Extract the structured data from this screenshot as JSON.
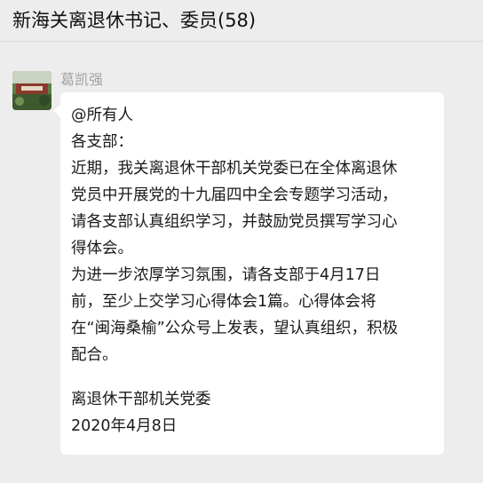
{
  "header": {
    "title": "新海关离退休书记、委员(58)"
  },
  "message": {
    "sender": "葛凯强",
    "avatar_icon": "group-photo-avatar-icon",
    "lines": [
      "@所有人",
      "各支部：",
      "近期，我关离退休干部机关党委已在全体离退休",
      "党员中开展党的十九届四中全会专题学习活动，",
      "请各支部认真组织学习，并鼓励党员撰写学习心",
      "得体会。",
      "为进一步浓厚学习氛围，请各支部于4月17日",
      "前，至少上交学习心得体会1篇。心得体会将",
      "在“闽海桑榆”公众号上发表，望认真组织，积极",
      "配合。",
      "离退休干部机关党委",
      "2020年4月8日"
    ]
  },
  "colors": {
    "background": "#ededed",
    "bubble": "#ffffff",
    "sender_name": "#a3a3a3",
    "text": "#1a1a1a"
  }
}
